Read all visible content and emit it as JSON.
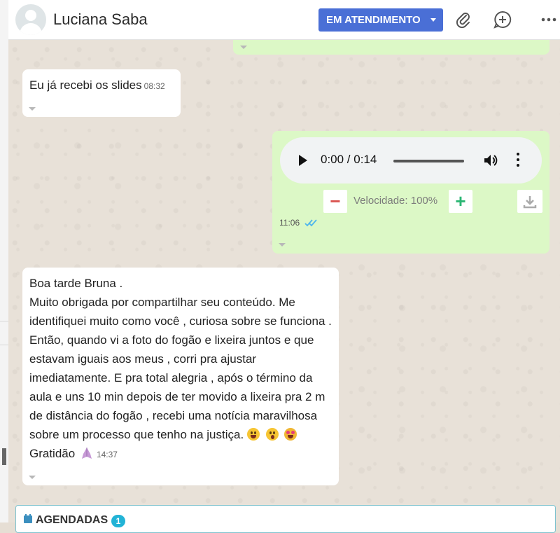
{
  "header": {
    "contact_name": "Luciana Saba",
    "status_label": "EM ATENDIMENTO",
    "status_color": "#4a6fd6",
    "icons": [
      "paperclip-icon",
      "add-chat-icon",
      "more-options-icon"
    ]
  },
  "messages": [
    {
      "direction": "incoming",
      "text": "Eu já recebi os slides",
      "time": "08:32"
    },
    {
      "direction": "outgoing",
      "type": "audio",
      "audio_time": "0:00 / 0:14",
      "speed_label": "Velocidade: 100%",
      "minus_label": "−",
      "plus_label": "+",
      "time": "11:06",
      "status": "read"
    },
    {
      "direction": "incoming",
      "lines": [
        "Boa tarde Bruna .",
        "Muito obrigada por compartilhar seu conteúdo. Me identifiquei muito como você , curiosa sobre se funciona . Então, quando vi a foto do fogão e lixeira juntos e que estavam iguais aos meus , corri pra ajustar imediatamente. E pra total alegria , após o término da aula e uns 10 min depois de ter movido a lixeira pra 2 m de distância do fogão , recebi uma notícia maravilhosa sobre um processo que tenho na justiça."
      ],
      "closing_text": "Gratidão",
      "emojis": [
        "grinning-face",
        "astonished-face",
        "star-struck-face",
        "praying-hands"
      ],
      "time": "14:37"
    }
  ],
  "agendadas": {
    "label": "AGENDADAS",
    "count": "1"
  },
  "colors": {
    "incoming_bubble": "#ffffff",
    "outgoing_bubble": "#dcf8c6",
    "read_ticks": "#4fb6ec"
  }
}
